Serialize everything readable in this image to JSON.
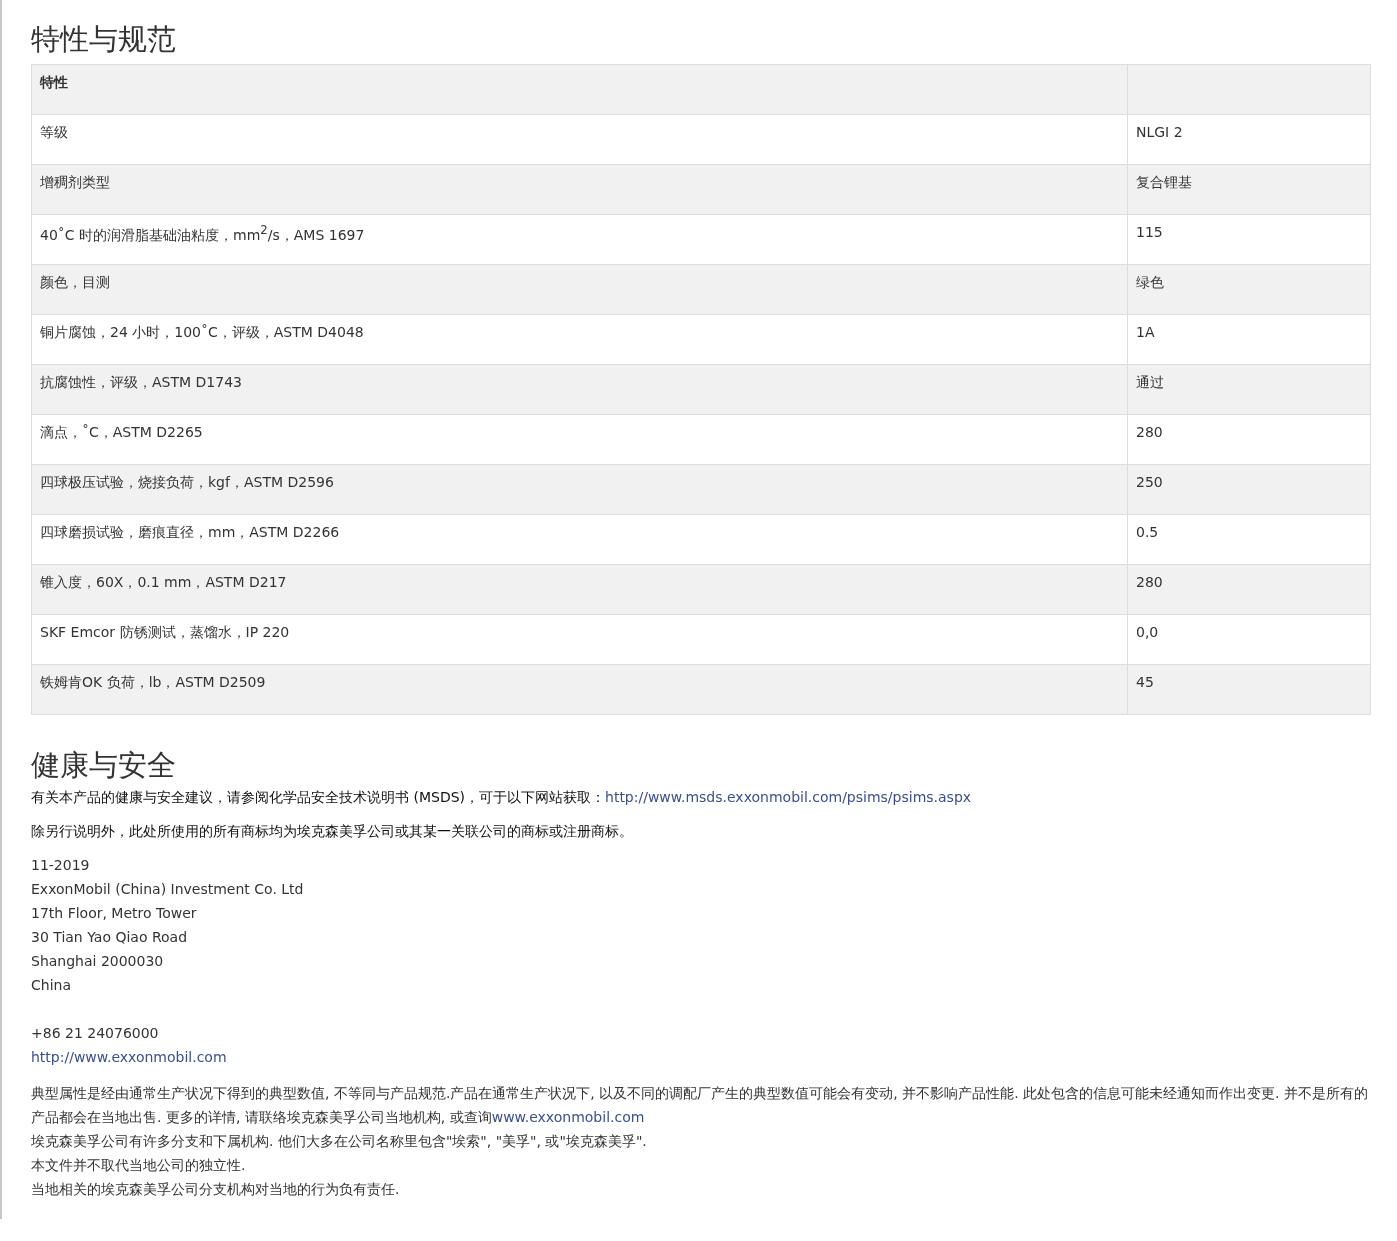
{
  "specs": {
    "title": "特性与规范",
    "table": {
      "header": "特性",
      "rows": [
        [
          "等级",
          "NLGI 2"
        ],
        [
          "增稠剂类型",
          "复合锂基"
        ],
        [
          "40˚C 时的润滑脂基础油粘度，mm$^{2}$/s，AMS 1697",
          "115"
        ],
        [
          "颜色，目测",
          "绿色"
        ],
        [
          "铜片腐蚀，24 小时，100˚C，评级，ASTM D4048",
          "1A"
        ],
        [
          "抗腐蚀性，评级，ASTM D1743",
          "通过"
        ],
        [
          "滴点，˚C，ASTM D2265",
          "280"
        ],
        [
          "四球极压试验，烧接负荷，kgf，ASTM D2596",
          "250"
        ],
        [
          "四球磨损试验，磨痕直径，mm，ASTM D2266",
          "0.5"
        ],
        [
          "锥入度，60X，0.1 mm，ASTM D217",
          "280"
        ],
        [
          "SKF Emcor 防锈测试，蒸馏水，IP 220",
          "0,0"
        ],
        [
          "铁姆肯OK 负荷，lb，ASTM D2509",
          "45"
        ]
      ]
    }
  },
  "health": {
    "title": "健康与安全",
    "msds_text": "有关本产品的健康与安全建议，请参阅化学品安全技术说明书 (MSDS)，可于以下网站获取：",
    "msds_link": "http://www.msds.exxonmobil.com/psims/psims.aspx",
    "trademark_note": "除另行说明外，此处所使用的所有商标均为埃克森美孚公司或其某一关联公司的商标或注册商标。",
    "address_lines": [
      "11-2019",
      "ExxonMobil (China) Investment Co. Ltd",
      "17th Floor, Metro Tower",
      "30 Tian Yao Qiao Road",
      "Shanghai 2000030",
      "China"
    ],
    "phone": "+86 21 24076000",
    "website": "http://www.exxonmobil.com",
    "disclaimer_text": "典型属性是经由通常生产状况下得到的典型数值, 不等同与产品规范.产品在通常生产状况下, 以及不同的调配厂产生的典型数值可能会有变动, 并不影响产品性能. 此处包含的信息可能未经通知而作出变更. 并不是所有的产品都会在当地出售.  更多的详情, 请联络埃克森美孚公司当地机构, 或查询",
    "disclaimer_link": "www.exxonmobil.com",
    "notes": [
      "埃克森美孚公司有许多分支和下属机构. 他们大多在公司名称里包含\"埃索\", \"美孚\", 或\"埃克森美孚\".",
      "本文件并不取代当地公司的独立性.",
      "当地相关的埃克森美孚公司分支机构对当地的行为负有责任."
    ]
  }
}
